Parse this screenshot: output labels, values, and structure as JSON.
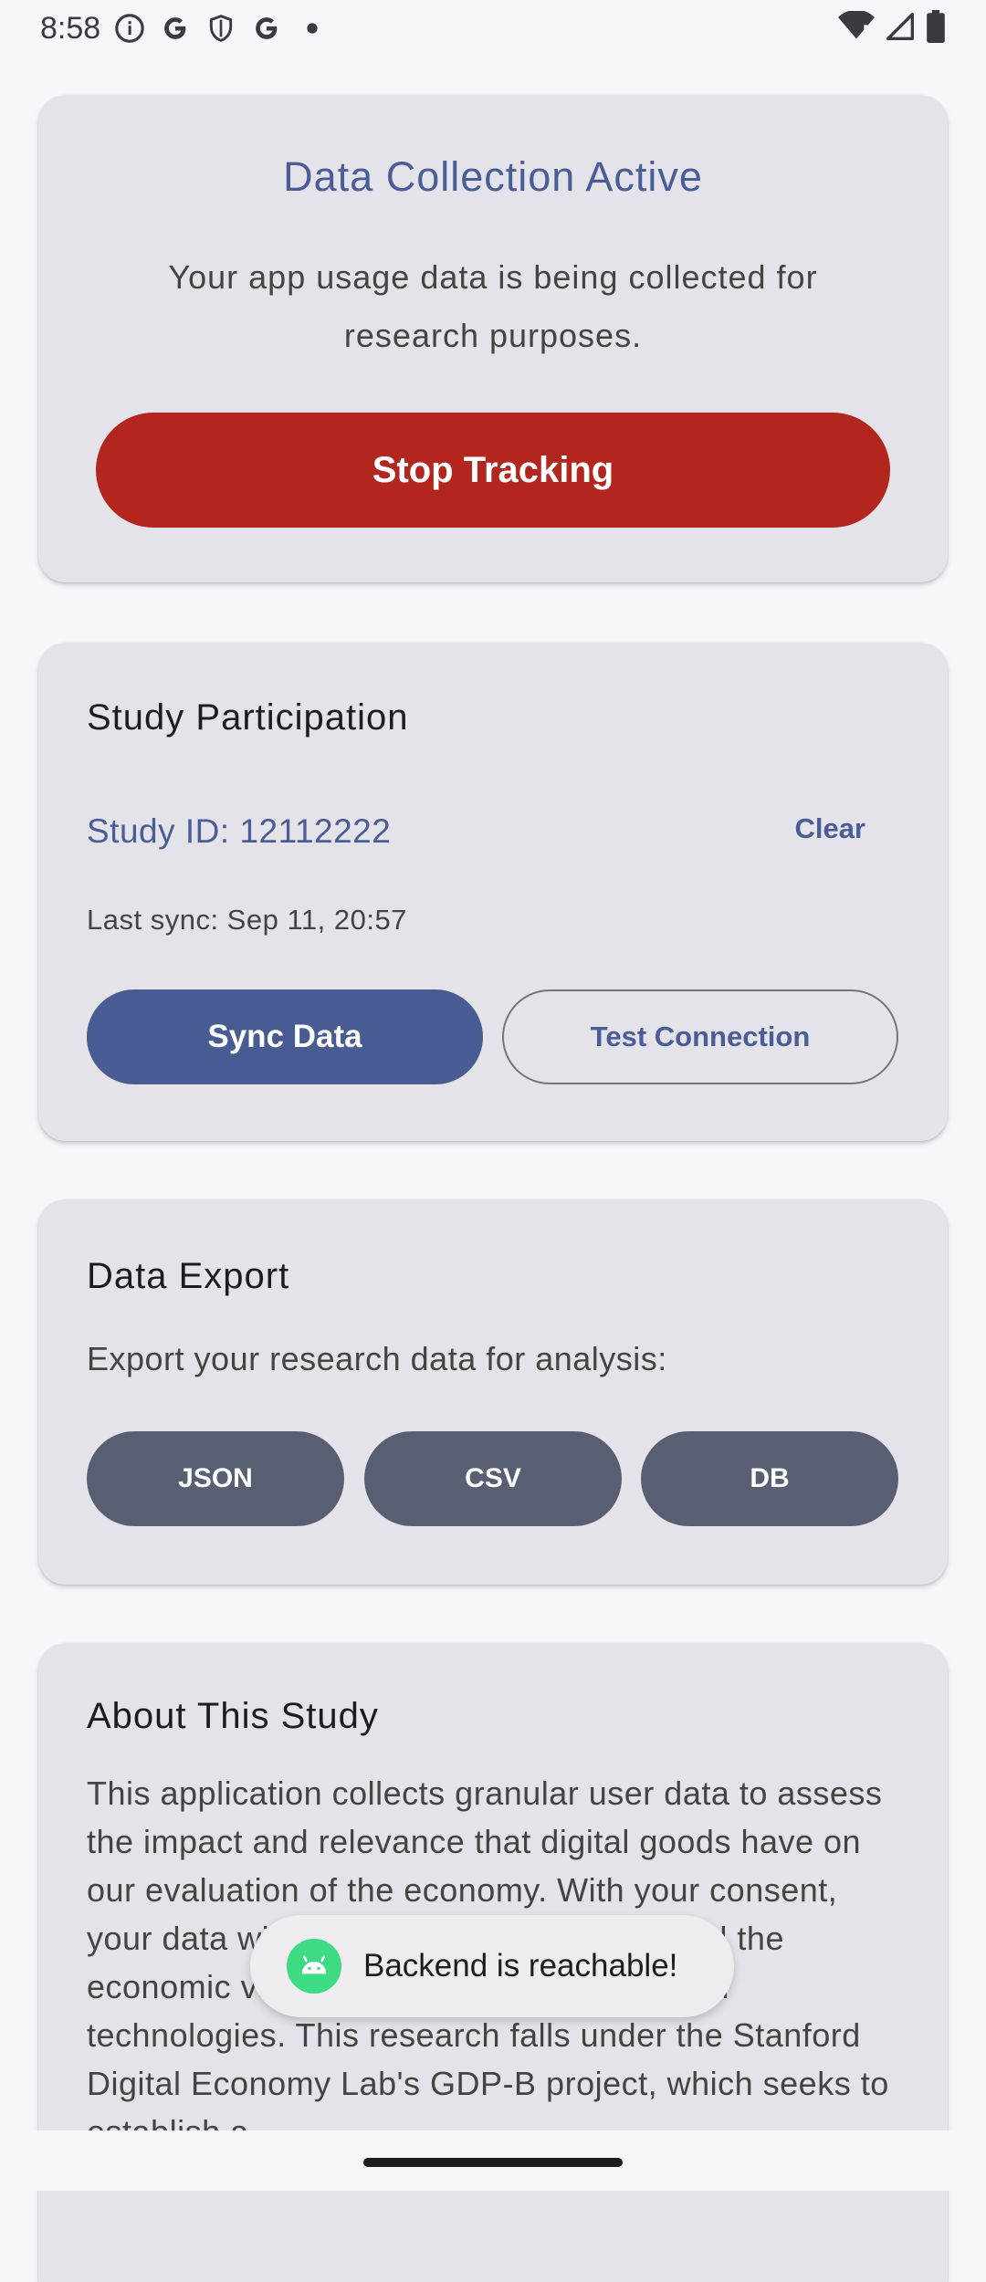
{
  "status_bar": {
    "time": "8:58",
    "left_icons": [
      "info-icon",
      "google-icon",
      "shield-icon",
      "google-icon",
      "dot-icon"
    ],
    "right_icons": [
      "wifi-icon",
      "signal-icon",
      "battery-icon"
    ]
  },
  "tracking_card": {
    "title": "Data Collection Active",
    "description": "Your app usage data is being collected for research purposes.",
    "stop_button": "Stop Tracking"
  },
  "study_card": {
    "title": "Study Participation",
    "study_id": "Study ID: 12112222",
    "clear_button": "Clear",
    "last_sync": "Last sync: Sep 11, 20:57",
    "sync_button": "Sync Data",
    "test_button": "Test Connection"
  },
  "export_card": {
    "title": "Data Export",
    "description": "Export your research data for analysis:",
    "buttons": [
      "JSON",
      "CSV",
      "DB"
    ]
  },
  "about_card": {
    "title": "About This Study",
    "body": "This application collects granular user data to assess the impact and relevance that digital goods have on our evaluation of the economy. With your consent, your data will be used to better understand the economic value placed upon distinct digital technologies. This research falls under the Stanford Digital Economy Lab's GDP-B project, which seeks to establish a"
  },
  "toast": {
    "message": "Backend is reachable!"
  },
  "colors": {
    "primary": "#4a5d96",
    "danger": "#b3261e",
    "secondary_button": "#595f72",
    "card": "#e4e3e9"
  }
}
